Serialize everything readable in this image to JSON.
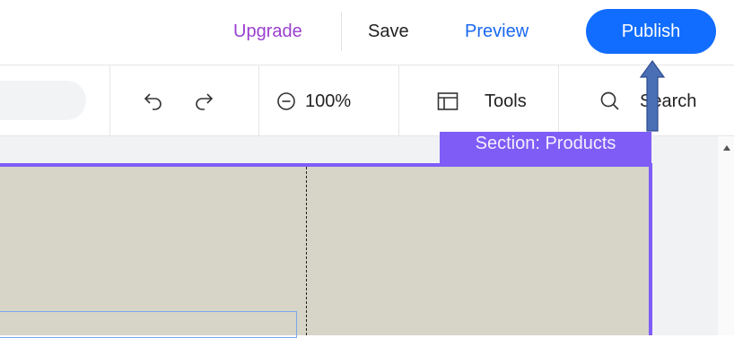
{
  "topbar": {
    "upgrade_label": "Upgrade",
    "save_label": "Save",
    "preview_label": "Preview",
    "publish_label": "Publish"
  },
  "toolbar": {
    "zoom_level": "100%",
    "tools_label": "Tools",
    "search_label": "Search"
  },
  "canvas": {
    "section_label": "Section: Products"
  },
  "colors": {
    "publish_bg": "#116dff",
    "upgrade_text": "#9a3fd0",
    "preview_text": "#1a68f0",
    "section_accent": "#7f5cf6",
    "section_bg": "#d6d5c8",
    "annotation_arrow": "#4a6fb5"
  }
}
